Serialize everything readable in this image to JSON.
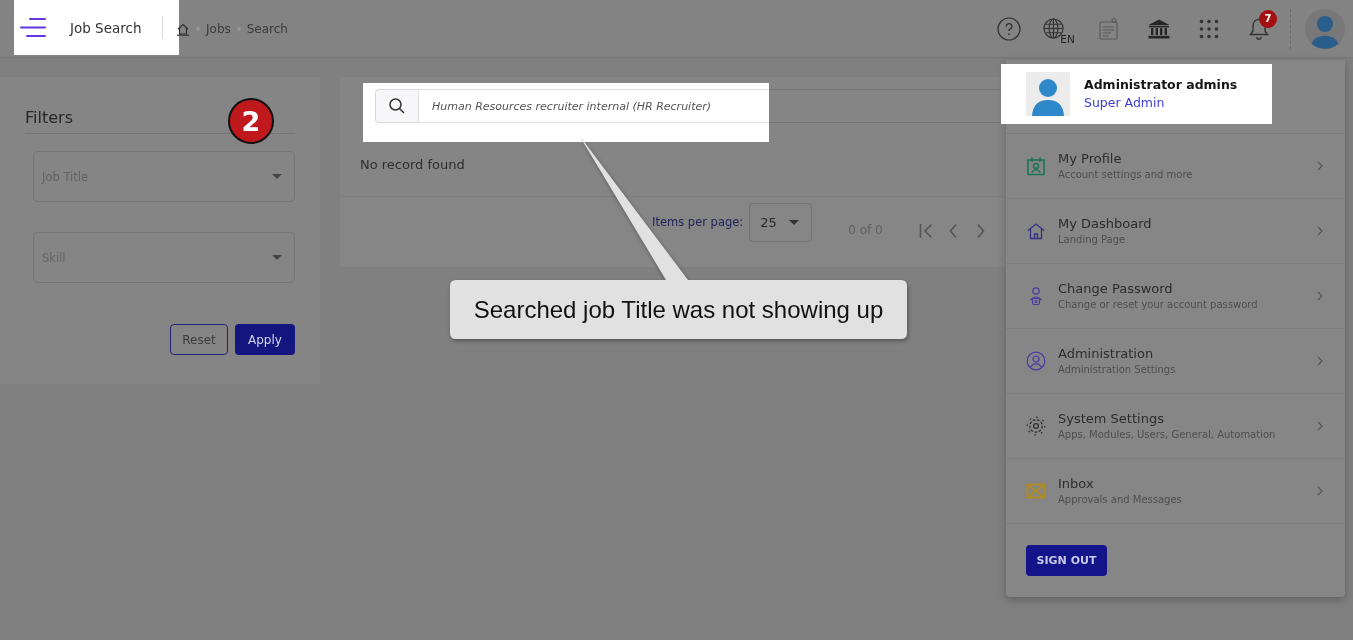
{
  "top_bar": {
    "brand": {
      "title": "Job Search",
      "highlighted": true
    },
    "breadcrumb": [
      "Jobs",
      "Search"
    ],
    "language": "EN",
    "notification_count": "7"
  },
  "filters": {
    "title": "Filters",
    "fields": [
      {
        "placeholder": "Job Title"
      },
      {
        "placeholder": "Skill"
      }
    ],
    "buttons": [
      {
        "label": "Reset",
        "kind": "outline"
      },
      {
        "label": "Apply",
        "kind": "primary"
      }
    ]
  },
  "search": {
    "value": "Human Resources recruiter internal (HR Recruiter)",
    "highlighted": true
  },
  "results": {
    "message": "No record found"
  },
  "paginator": {
    "label": "Items per page:",
    "page_size": "25",
    "range": "0 of 0"
  },
  "profile_menu": {
    "header": {
      "name": "Administrator admins",
      "role": "Super Admin",
      "highlighted": true
    },
    "items": [
      {
        "title": "My Profile",
        "subtitle": "Account settings and more"
      },
      {
        "title": "My Dashboard",
        "subtitle": "Landing Page"
      },
      {
        "title": "Change Password",
        "subtitle": "Change or reset your account password"
      },
      {
        "title": "Administration",
        "subtitle": "Administration Settings"
      },
      {
        "title": "System Settings",
        "subtitle": "Apps, Modules, Users, General, Automation"
      },
      {
        "title": "Inbox",
        "subtitle": "Approvals and Messages"
      }
    ],
    "sign_out": "SIGN OUT"
  },
  "annotations": {
    "step_marker": "2",
    "callout": "Searched job Title was not showing up"
  }
}
